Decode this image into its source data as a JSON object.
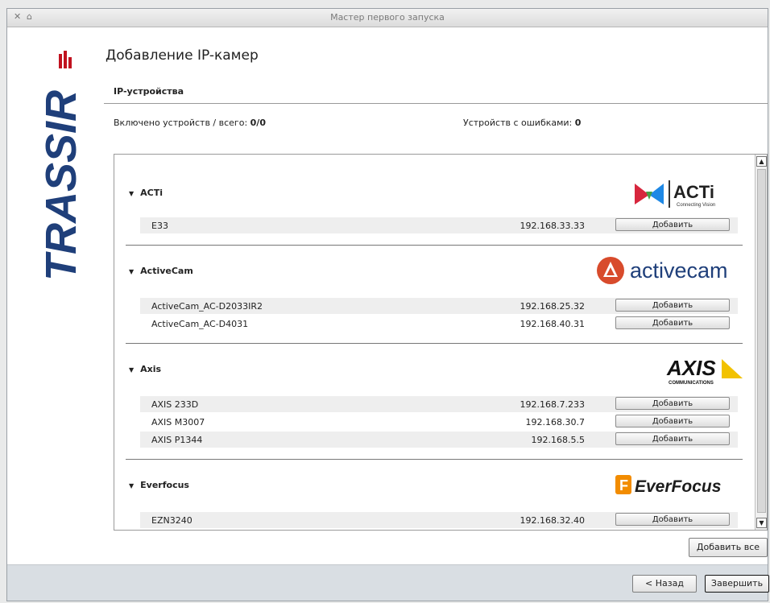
{
  "window": {
    "title": "Мастер первого запуска",
    "brand_logo_text": "TRASSIR"
  },
  "page": {
    "title": "Добавление IP-камер",
    "section_title": "IP-устройства"
  },
  "stats": {
    "enabled_label": "Включено устройств / всего:",
    "enabled_value": "0/0",
    "errors_label": "Устройств с ошибками:",
    "errors_value": "0"
  },
  "groups": [
    {
      "name": "ACTi",
      "logo": "ACTi",
      "logo_sub": "Connecting Vision",
      "devices": [
        {
          "name": "E33",
          "ip": "192.168.33.33",
          "button": "Добавить"
        }
      ]
    },
    {
      "name": "ActiveCam",
      "logo": "activecam",
      "devices": [
        {
          "name": "ActiveCam_AC-D2033IR2",
          "ip": "192.168.25.32",
          "button": "Добавить"
        },
        {
          "name": "ActiveCam_AC-D4031",
          "ip": "192.168.40.31",
          "button": "Добавить"
        }
      ]
    },
    {
      "name": "Axis",
      "logo": "AXIS",
      "logo_sub": "COMMUNICATIONS",
      "devices": [
        {
          "name": "AXIS 233D",
          "ip": "192.168.7.233",
          "button": "Добавить"
        },
        {
          "name": "AXIS M3007",
          "ip": "192.168.30.7",
          "button": "Добавить"
        },
        {
          "name": "AXIS P1344",
          "ip": "192.168.5.5",
          "button": "Добавить"
        }
      ]
    },
    {
      "name": "Everfocus",
      "logo": "EverFocus",
      "devices": [
        {
          "name": "EZN3240",
          "ip": "192.168.32.40",
          "button": "Добавить"
        }
      ]
    }
  ],
  "actions": {
    "add_all": "Добавить все",
    "back": "< Назад",
    "finish": "Завершить"
  },
  "icons": {
    "expand": "caret-down-icon",
    "scroll_up": "scroll-up-arrow-icon",
    "scroll_down": "scroll-down-arrow-icon"
  },
  "colors": {
    "trassir_blue": "#1f3f7a",
    "trassir_red": "#c1121f",
    "activecam_red": "#d84b2c",
    "axis_yellow": "#f2c200",
    "everfocus_orange": "#f28c00"
  }
}
